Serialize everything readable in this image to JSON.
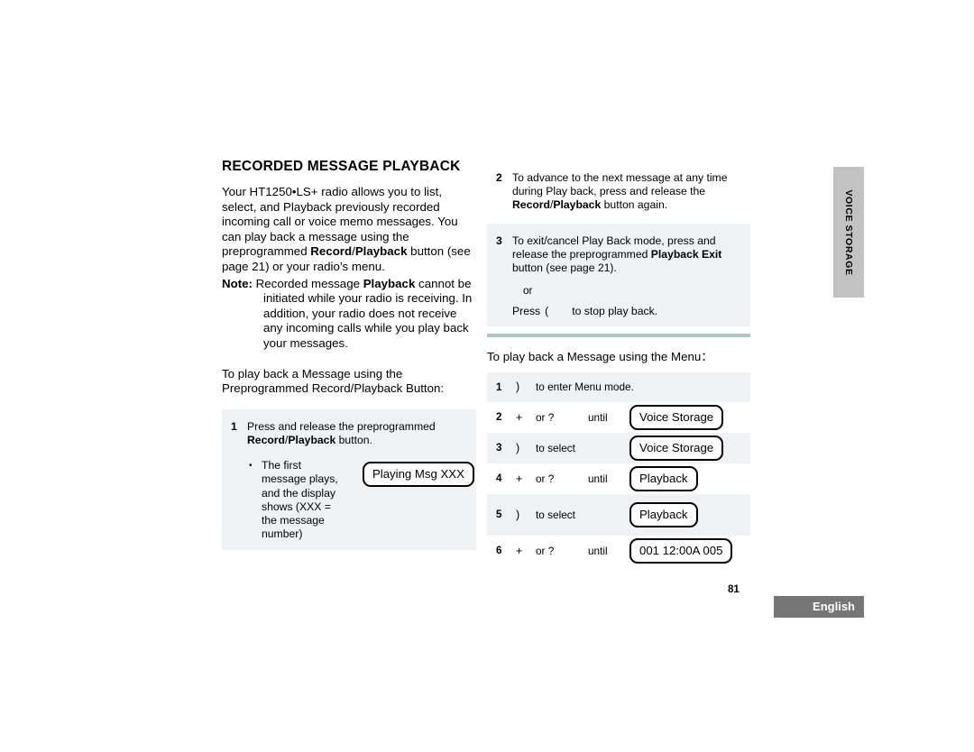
{
  "page": {
    "number": "81",
    "language_tab": "English",
    "side_tab": "VOICE STORAGE"
  },
  "left_column": {
    "title": "RECORDED MESSAGE PLAYBACK",
    "intro_part1": "Your HT1250",
    "intro_bullet_sep": "•",
    "intro_part2": "LS+ radio allows you to list, select, and Playback previously recorded incoming call or voice memo messages. You can play back a message using the preprogrammed ",
    "intro_bold_record": "Record",
    "intro_slash": "/",
    "intro_bold_playback": "Playback",
    "intro_part3": " button (see page 21) or your radio’s menu.",
    "note_label": "Note:",
    "note_text_a": " Recorded message ",
    "note_bold": "Playback",
    "note_text_b": " cannot be initiated while your radio is receiving. In addition, your radio does not receive any incoming calls while you play back your messages.",
    "note_display": "Playing Msg XXX",
    "lead_in": "To play back a Message using the Preprogrammed Record/Playback Button:",
    "step1": {
      "number": "1",
      "text_a": "Press and release the preprogrammed ",
      "bold_record": "Record",
      "slash": "/",
      "bold_playback": "Playback",
      "text_b": " button."
    },
    "bullet": {
      "marker": "•",
      "text": "The first message plays, and the display shows (XXX = the message number)",
      "display": "Playing Msg XXX"
    }
  },
  "right_column": {
    "step2": {
      "number": "2",
      "text_a": "To advance to the next message at any time during Play back, press and release the ",
      "bold_record": "Record",
      "slash": "/",
      "bold_playback": "Playback",
      "text_b": " button again."
    },
    "step3": {
      "number": "3",
      "text_a": "To exit/cancel Play Back mode, press and release the preprogrammed ",
      "bold_exit": "Playback Exit",
      "text_b": " button (see page 21).",
      "or": "or",
      "press_label": "Press",
      "press_key_icon": "(",
      "press_text": "to stop play back."
    },
    "menu_lead": "To play back a Message using the Menu：",
    "menu_rows": [
      {
        "number": "1",
        "key": ")",
        "mid": "to enter Menu mode.",
        "until": "",
        "display": ""
      },
      {
        "number": "2",
        "key": "+",
        "mid": "or  ?",
        "until": "until",
        "display": "Voice Storage"
      },
      {
        "number": "3",
        "key": ")",
        "mid": "to select",
        "until": "",
        "display": "Voice Storage"
      },
      {
        "number": "4",
        "key": "+",
        "mid": "or  ?",
        "until": "until",
        "display": "Playback"
      },
      {
        "number": "5",
        "key": ")",
        "mid": "to select",
        "until": "",
        "display": "Playback"
      },
      {
        "number": "6",
        "key": "+",
        "mid": "or  ?",
        "until": "until",
        "display": "001 12:00A 005"
      }
    ]
  },
  "colors": {
    "shade": "#eef2f5",
    "rule": "#a9c6ce",
    "side_tab": "#c2c2c2",
    "lang_box": "#767676"
  }
}
